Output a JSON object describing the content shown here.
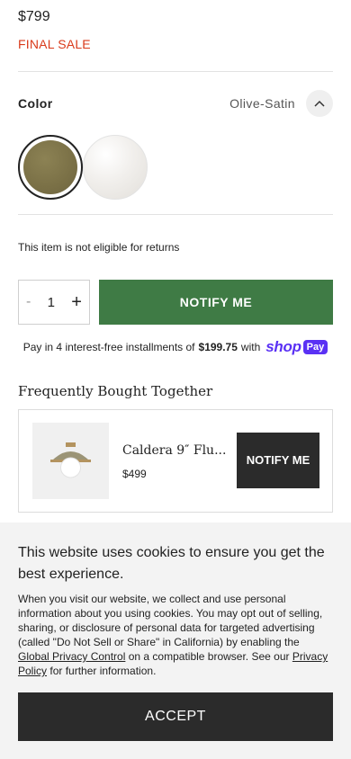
{
  "product": {
    "price": "$799",
    "sale_badge": "FINAL SALE",
    "color_label": "Color",
    "color_value": "Olive-Satin",
    "returns_note": "This item is not eligible for returns",
    "quantity": "1",
    "qty_minus": "-",
    "qty_plus": "+",
    "notify_label": "NOTIFY ME"
  },
  "swatches": [
    {
      "name": "Olive",
      "color": "#7a7046",
      "selected": true
    },
    {
      "name": "Satin",
      "color": "#efedea",
      "selected": false
    }
  ],
  "installments": {
    "prefix": "Pay in 4 interest-free installments of",
    "amount": "$199.75",
    "suffix": "with",
    "brand_shop": "shop",
    "brand_pay": "Pay"
  },
  "fbt": {
    "title": "Frequently Bought Together",
    "items": [
      {
        "name": "Caldera 9″ Flu...",
        "price": "$499",
        "notify_label": "NOTIFY ME"
      }
    ]
  },
  "cookie": {
    "title": "This website uses cookies to ensure you get the best experience.",
    "body_part1": "When you visit our website, we collect and use personal information about you using cookies. You may opt out of selling, sharing, or disclosure of personal data for targeted advertising (called \"Do Not Sell or Share\" in California) by enabling the",
    "link1": "Global Privacy Control",
    "body_part2": "on a compatible browser. See our",
    "link2": "Privacy Policy",
    "body_part3": "for further information.",
    "accept_label": "ACCEPT"
  },
  "colors": {
    "sale_red": "#d93a1b",
    "notify_green": "#3f7b45",
    "dark_button": "#2b2b2b",
    "shop_pay_purple": "#5a31f4"
  }
}
